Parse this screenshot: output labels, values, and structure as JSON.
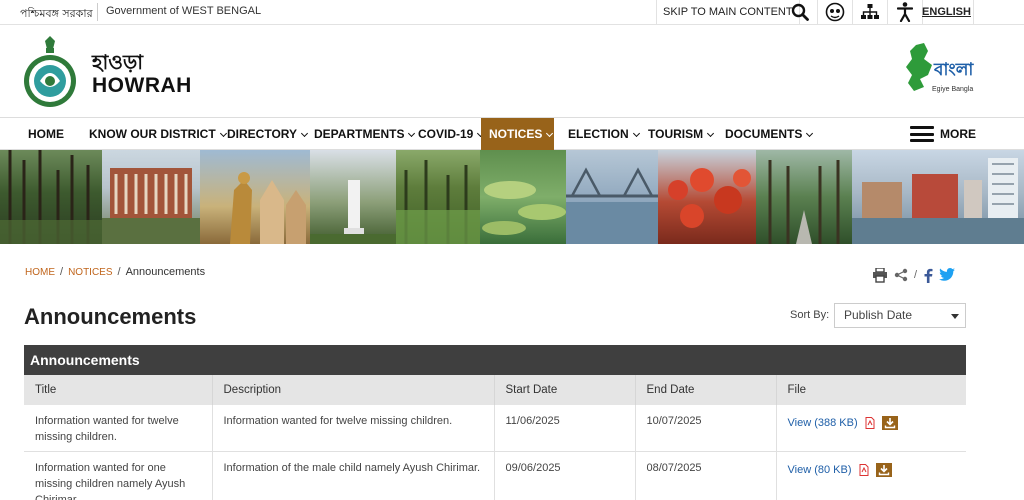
{
  "topbar": {
    "state_bn": "পশ্চিমবঙ্গ সরকার",
    "state_en": "Government of WEST BENGAL",
    "skip": "SKIP TO MAIN CONTENT",
    "language": "ENGLISH"
  },
  "header": {
    "name_bn": "হাওড়া",
    "name_en": "HOWRAH",
    "campaign_title": "বাংলা",
    "campaign_tag": "Egiye Bangla"
  },
  "nav": {
    "items": [
      {
        "label": "HOME",
        "dropdown": false,
        "active": false
      },
      {
        "label": "KNOW OUR DISTRICT",
        "dropdown": true,
        "active": false
      },
      {
        "label": "DIRECTORY",
        "dropdown": true,
        "active": false
      },
      {
        "label": "DEPARTMENTS",
        "dropdown": true,
        "active": false
      },
      {
        "label": "COVID-19",
        "dropdown": true,
        "active": false
      },
      {
        "label": "NOTICES",
        "dropdown": true,
        "active": true
      },
      {
        "label": "ELECTION",
        "dropdown": true,
        "active": false
      },
      {
        "label": "TOURISM",
        "dropdown": true,
        "active": false
      },
      {
        "label": "DOCUMENTS",
        "dropdown": true,
        "active": false
      }
    ],
    "more": "MORE",
    "active_color": "#98631a"
  },
  "breadcrumb": {
    "home": "HOME",
    "notices": "NOTICES",
    "current": "Announcements"
  },
  "page": {
    "title": "Announcements",
    "sort_label": "Sort By:",
    "sort_value": "Publish Date"
  },
  "table": {
    "caption": "Announcements",
    "headers": [
      "Title",
      "Description",
      "Start Date",
      "End Date",
      "File"
    ],
    "rows": [
      {
        "title": "Information wanted for twelve missing children.",
        "description": "Information wanted for twelve missing children.",
        "start": "11/06/2025",
        "end": "10/07/2025",
        "file": "View (388 KB)"
      },
      {
        "title": "Information wanted for one missing children namely Ayush Chirimar.",
        "description": "Information of the male child namely Ayush Chirimar.",
        "start": "09/06/2025",
        "end": "08/07/2025",
        "file": "View (80 KB)"
      }
    ]
  },
  "icons": {
    "search": "search-icon",
    "accessibility": "accessibility-icon",
    "sitemap": "sitemap-icon",
    "screen_reader": "screen-reader-icon",
    "print": "print-icon",
    "share": "share-icon",
    "facebook": "facebook-icon",
    "twitter": "twitter-icon",
    "pdf": "pdf-icon",
    "download": "download-icon"
  },
  "colors": {
    "brand_brown": "#98631a",
    "link_blue": "#1f5fa8",
    "breadcrumb_orange": "#c0651c",
    "table_caption": "#3f3f3f"
  }
}
